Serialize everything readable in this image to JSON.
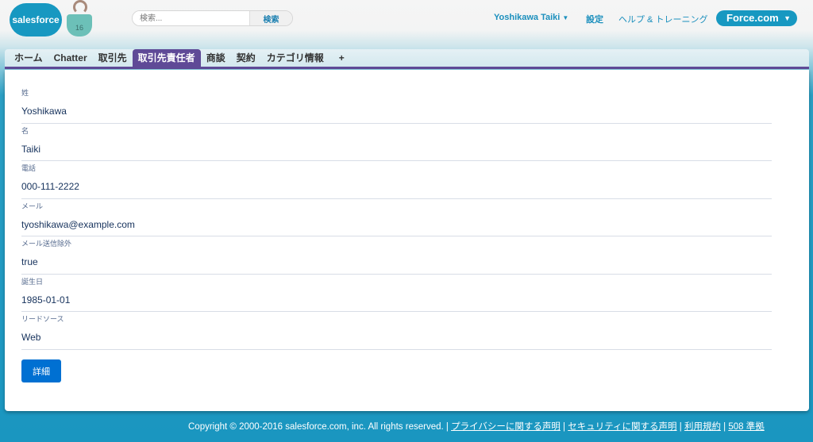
{
  "header": {
    "logo_text": "salesforce",
    "mascot_badge": "16",
    "search_placeholder": "検索...",
    "search_button": "検索",
    "user_menu": "Yoshikawa Taiki",
    "settings": "設定",
    "help": "ヘルプ & トレーニング",
    "app_switcher": "Force.com"
  },
  "tabs": [
    {
      "label": "ホーム"
    },
    {
      "label": "Chatter"
    },
    {
      "label": "取引先"
    },
    {
      "label": "取引先責任者",
      "active": true
    },
    {
      "label": "商談"
    },
    {
      "label": "契約"
    },
    {
      "label": "カテゴリ情報"
    },
    {
      "label": "+"
    }
  ],
  "fields": [
    {
      "label": "姓",
      "value": "Yoshikawa"
    },
    {
      "label": "名",
      "value": "Taiki"
    },
    {
      "label": "電話",
      "value": "000-111-2222"
    },
    {
      "label": "メール",
      "value": "tyoshikawa@example.com"
    },
    {
      "label": "メール送信除外",
      "value": "true"
    },
    {
      "label": "誕生日",
      "value": "1985-01-01"
    },
    {
      "label": "リードソース",
      "value": "Web"
    }
  ],
  "detail_button": "詳細",
  "footer": {
    "copyright": "Copyright © 2000-2016 salesforce.com, inc. All rights reserved.",
    "links": [
      "プライバシーに関する声明",
      "セキュリティに関する声明",
      "利用規約",
      "508 準拠"
    ]
  },
  "colors": {
    "brand": "#1798c1",
    "tab_active": "#5f4a97",
    "button": "#0070d2"
  }
}
